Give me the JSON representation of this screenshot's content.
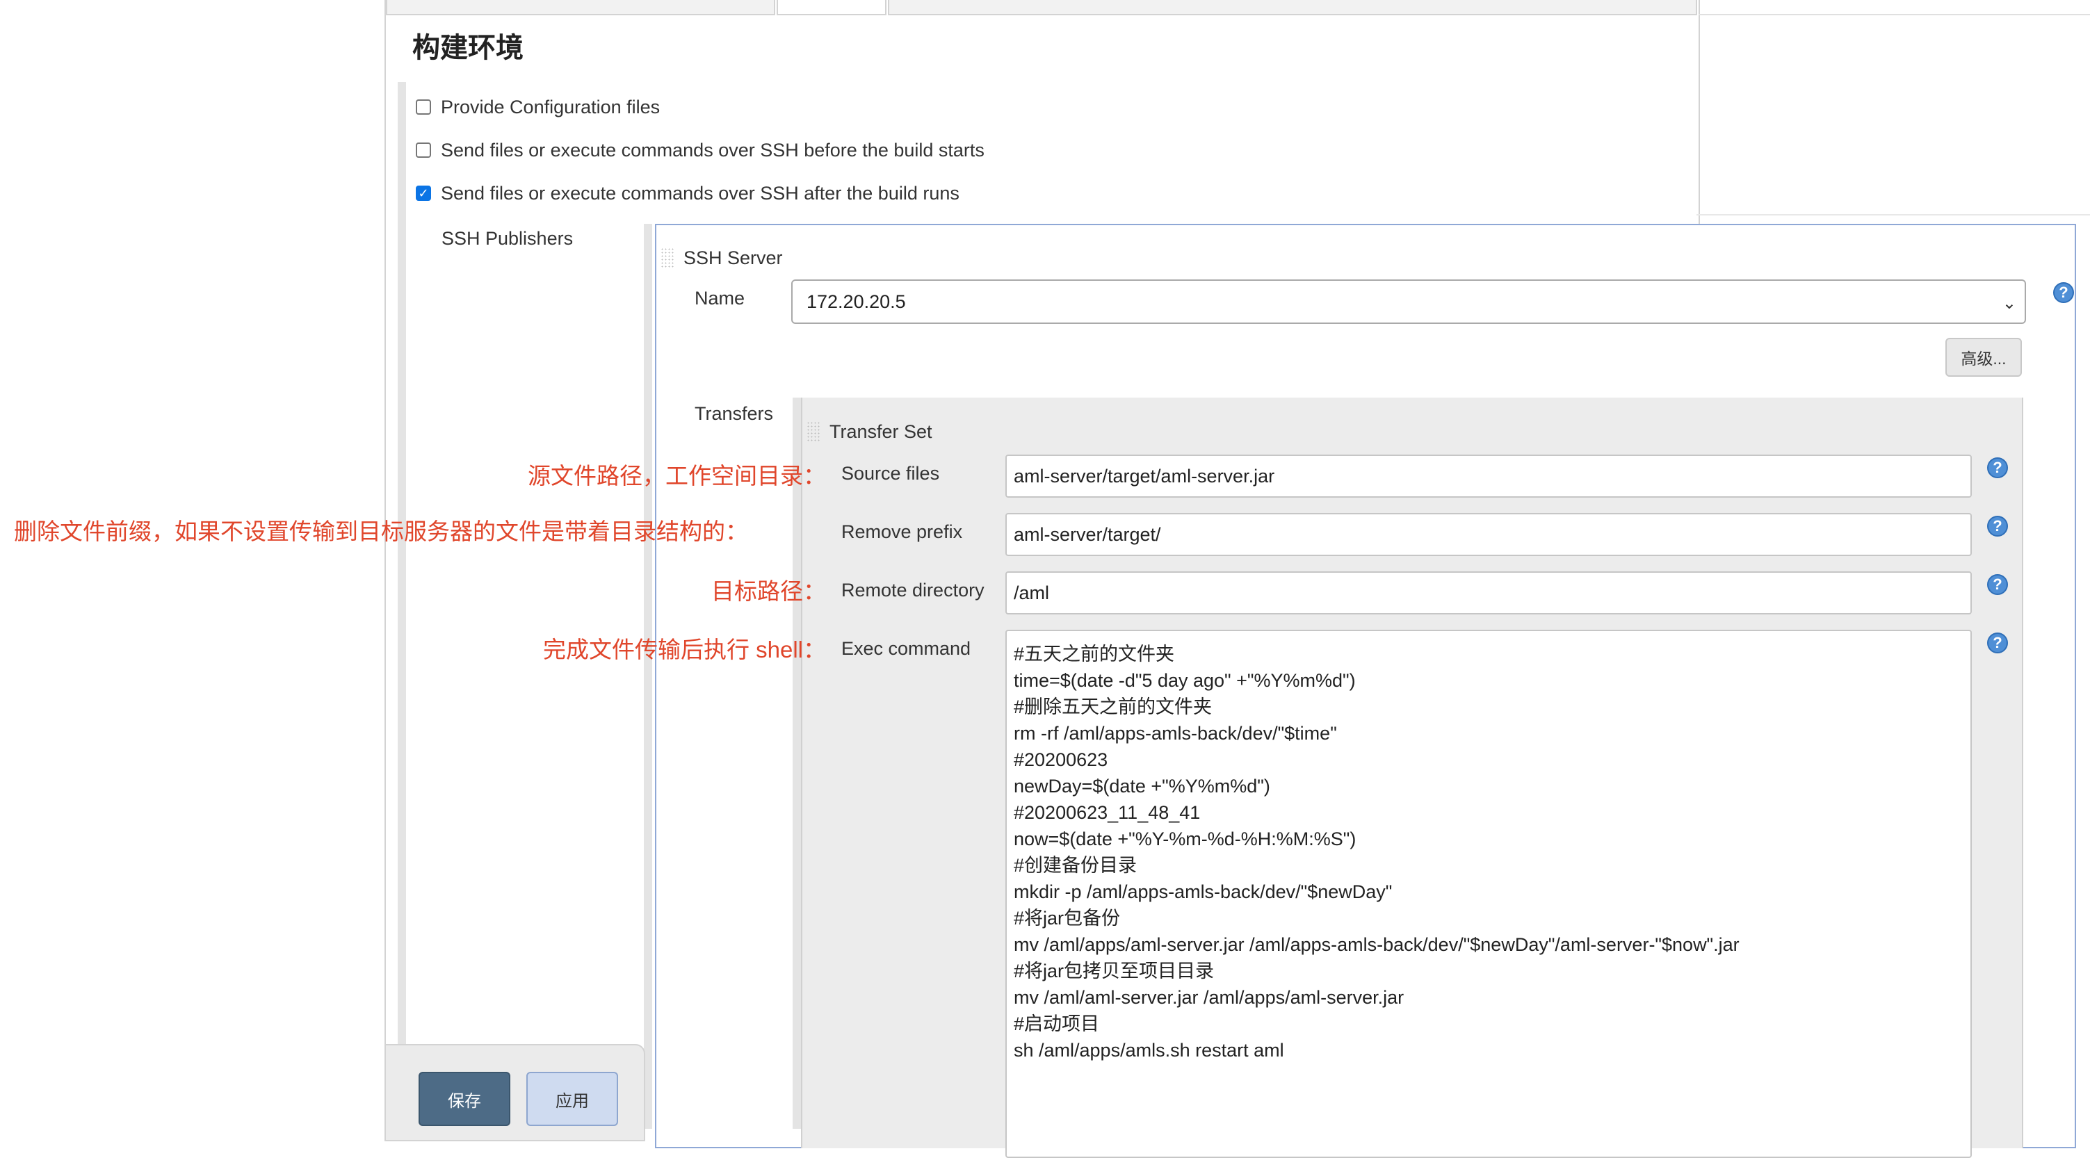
{
  "page": {
    "section_title": "构建环境"
  },
  "build_env_options": [
    {
      "label": "Provide Configuration files",
      "checked": false
    },
    {
      "label": "Send files or execute commands over SSH before the build starts",
      "checked": false
    },
    {
      "label": "Send files or execute commands over SSH after the build runs",
      "checked": true
    }
  ],
  "ssh_publishers": {
    "label": "SSH Publishers",
    "server_title": "SSH Server",
    "name_label": "Name",
    "name_value": "172.20.20.5",
    "advanced_label": "高级...",
    "transfers_label": "Transfers",
    "transfer_set": {
      "title": "Transfer Set",
      "source_files_label": "Source files",
      "source_files_value": "aml-server/target/aml-server.jar",
      "remove_prefix_label": "Remove prefix",
      "remove_prefix_value": "aml-server/target/",
      "remote_directory_label": "Remote directory",
      "remote_directory_value": "/aml",
      "exec_command_label": "Exec command",
      "exec_command_lines": [
        "#五天之前的文件夹",
        "time=$(date -d\"5 day ago\" +\"%Y%m%d\")",
        "#删除五天之前的文件夹",
        "rm -rf /aml/apps-amls-back/dev/\"$time\"",
        "#20200623",
        "newDay=$(date +\"%Y%m%d\")",
        "#20200623_11_48_41",
        "now=$(date +\"%Y-%m-%d-%H:%M:%S\")",
        "#创建备份目录",
        "mkdir -p /aml/apps-amls-back/dev/\"$newDay\"",
        "#将jar包备份",
        "mv /aml/apps/aml-server.jar /aml/apps-amls-back/dev/\"$newDay\"/aml-server-\"$now\".jar",
        "#将jar包拷贝至项目目录",
        "mv /aml/aml-server.jar /aml/apps/aml-server.jar",
        "#启动项目",
        "sh /aml/apps/amls.sh restart aml"
      ]
    }
  },
  "annotations": {
    "source": "源文件路径，工作空间目录：",
    "remove_prefix": "删除文件前缀，如果不设置传输到目标服务器的文件是带着目录结构的：",
    "remote": "目标路径：",
    "exec": "完成文件传输后执行 shell："
  },
  "bottom_bar": {
    "save_label": "保存",
    "apply_label": "应用"
  },
  "icons": {
    "help": "?",
    "check": "✓",
    "select_chevron": "⌄"
  },
  "colors": {
    "annotation": "#e0462b",
    "checkbox_checked": "#0b74e5",
    "save_button": "#4d6b86",
    "apply_button": "#cfdbf0",
    "help_icon": "#4f8fd6"
  }
}
